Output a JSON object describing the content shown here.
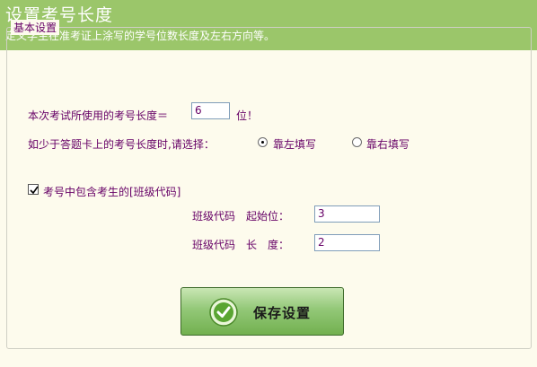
{
  "header": {
    "title": "设置考号长度",
    "subtitle": "定义学生在准考证上涂写的学号位数长度及左右方向等。"
  },
  "group": {
    "legend": "基本设置"
  },
  "exam_length": {
    "label": "本次考试所使用的考号长度＝",
    "value": "6",
    "unit": "位！"
  },
  "alignment": {
    "prompt": "如少于答题卡上的考号长度时,请选择：",
    "options": [
      {
        "label": "靠左填写",
        "selected": true
      },
      {
        "label": "靠右填写",
        "selected": false
      }
    ]
  },
  "include_class": {
    "label": "考号中包含考生的[班级代码]",
    "checked": true
  },
  "class_code": {
    "start_label": "班级代码　起始位：",
    "start_value": "3",
    "length_label": "班级代码　长　度：",
    "length_value": "2"
  },
  "save_button": {
    "label": "保存设置",
    "icon": "check-circle-icon"
  },
  "colors": {
    "header_bg": "#9bc66a",
    "panel_bg": "#fdfbed",
    "label_text": "#660066",
    "button_green": "#72b04f"
  }
}
